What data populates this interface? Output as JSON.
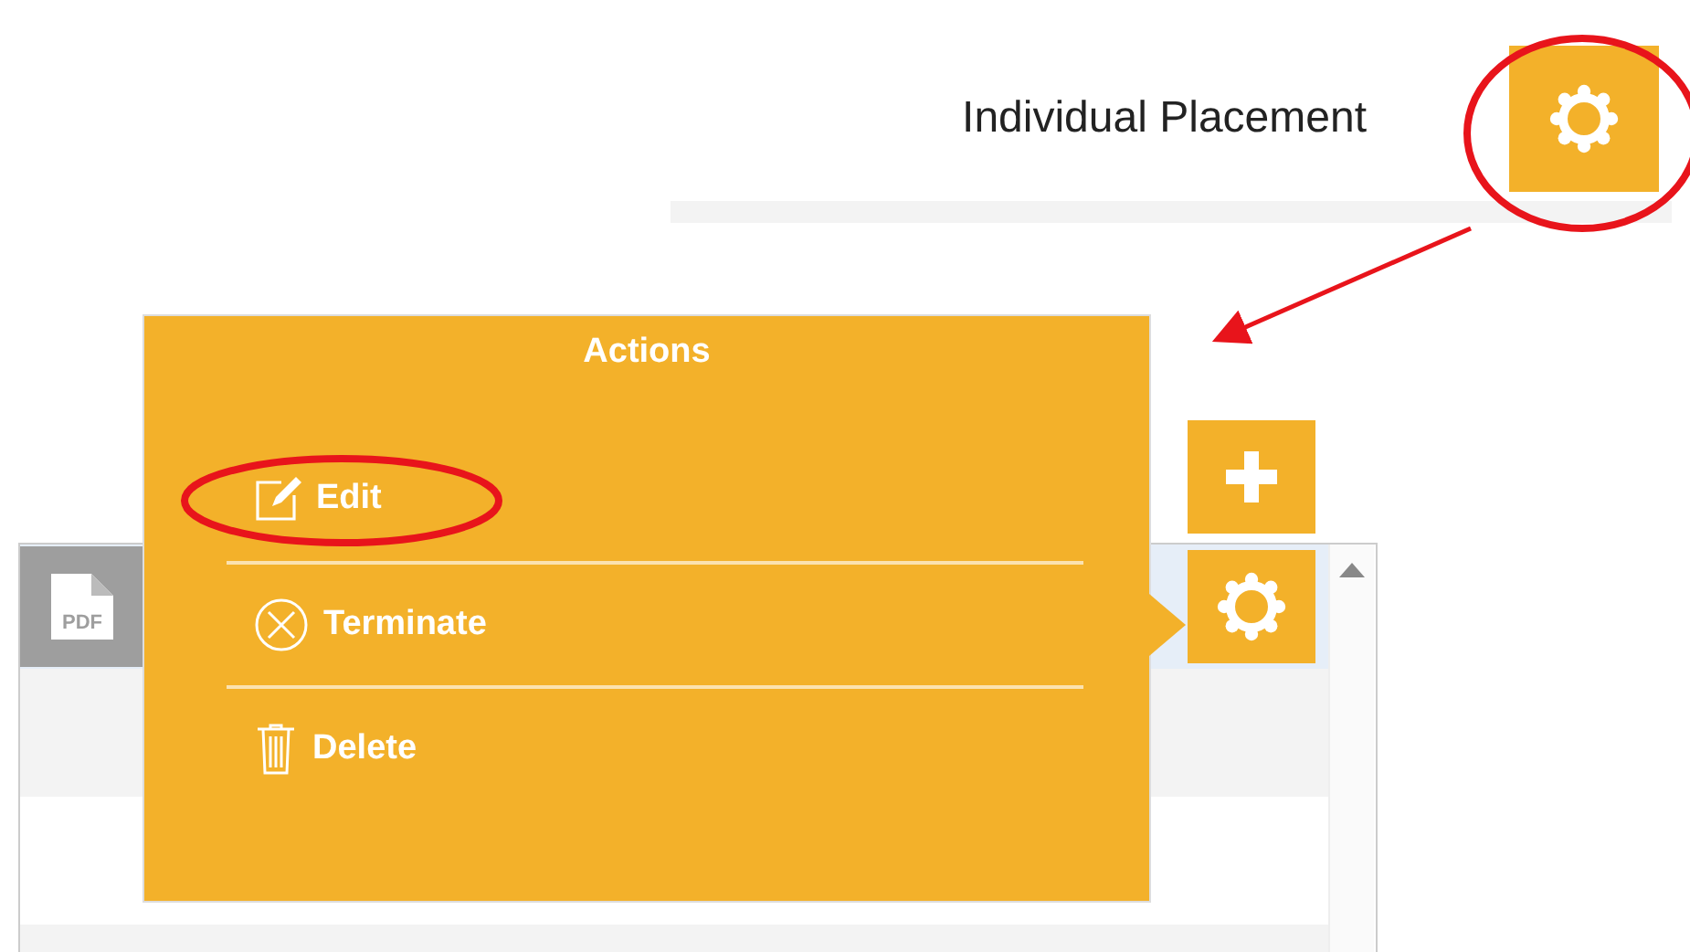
{
  "header": {
    "title": "Individual Placement"
  },
  "list": {
    "rows": [
      {
        "selected": true,
        "file_label": "PDF"
      },
      {
        "selected": false
      },
      {
        "selected": false
      },
      {
        "selected": false
      }
    ]
  },
  "actions_menu": {
    "title": "Actions",
    "items": [
      {
        "kind": "edit",
        "label": "Edit"
      },
      {
        "kind": "terminate",
        "label": "Terminate"
      },
      {
        "kind": "delete",
        "label": "Delete"
      }
    ]
  }
}
